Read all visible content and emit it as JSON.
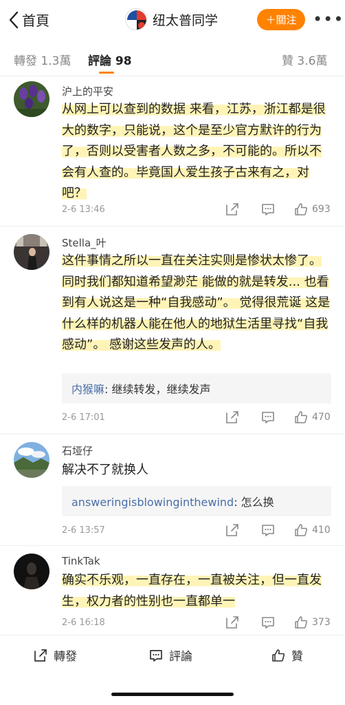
{
  "header": {
    "back_label": "首頁",
    "title": "纽太普同学",
    "follow_label": "＋關注",
    "more_label": "•••"
  },
  "tabs": [
    {
      "label": "轉發 1.3萬"
    },
    {
      "label": "評論 98"
    },
    {
      "label": "贊 3.6萬"
    }
  ],
  "comments": [
    {
      "name": "沪上的平安",
      "text": "从网上可以查到的数据 来看，江苏，浙江都是很大的数字，只能说，这个是至少官方默许的行为了，否则以受害者人数之多，不可能的。所以不会有人查的。毕竟国人爱生孩子古来有之，对吧？",
      "time": "2-6 13:46",
      "likes": "693"
    },
    {
      "name": "Stella_叶",
      "text": "这件事情之所以一直在关注实则是惨状太惨了。 同时我们都知道希望渺茫 能做的就是转发... 也看到有人说这是一种“自我感动”。 觉得很荒诞 这是什么样的机器人能在他人的地狱生活里寻找“自我感动”。  感谢这些发声的人。",
      "reply_user": "内猴嘛",
      "reply_text": ": 继续转发，继续发声",
      "time": "2-6 17:01",
      "likes": "470"
    },
    {
      "name": "石垭仔",
      "text": "解决不了就换人",
      "reply_user": "answeringisblowinginthewind",
      "reply_text": ": 怎么换",
      "time": "2-6 13:57",
      "likes": "410"
    },
    {
      "name": "TinkTak",
      "text": "确实不乐观，一直存在，一直被关注，但一直发生，权力者的性别也一直都单一",
      "time": "2-6 16:18",
      "likes": "373"
    }
  ],
  "footer": {
    "repost_label": "轉發",
    "comment_label": "評論",
    "like_label": "贊"
  },
  "colors": {
    "accent": "#ff8200",
    "link": "#4a6ea9",
    "highlight": "#fff2aa"
  }
}
